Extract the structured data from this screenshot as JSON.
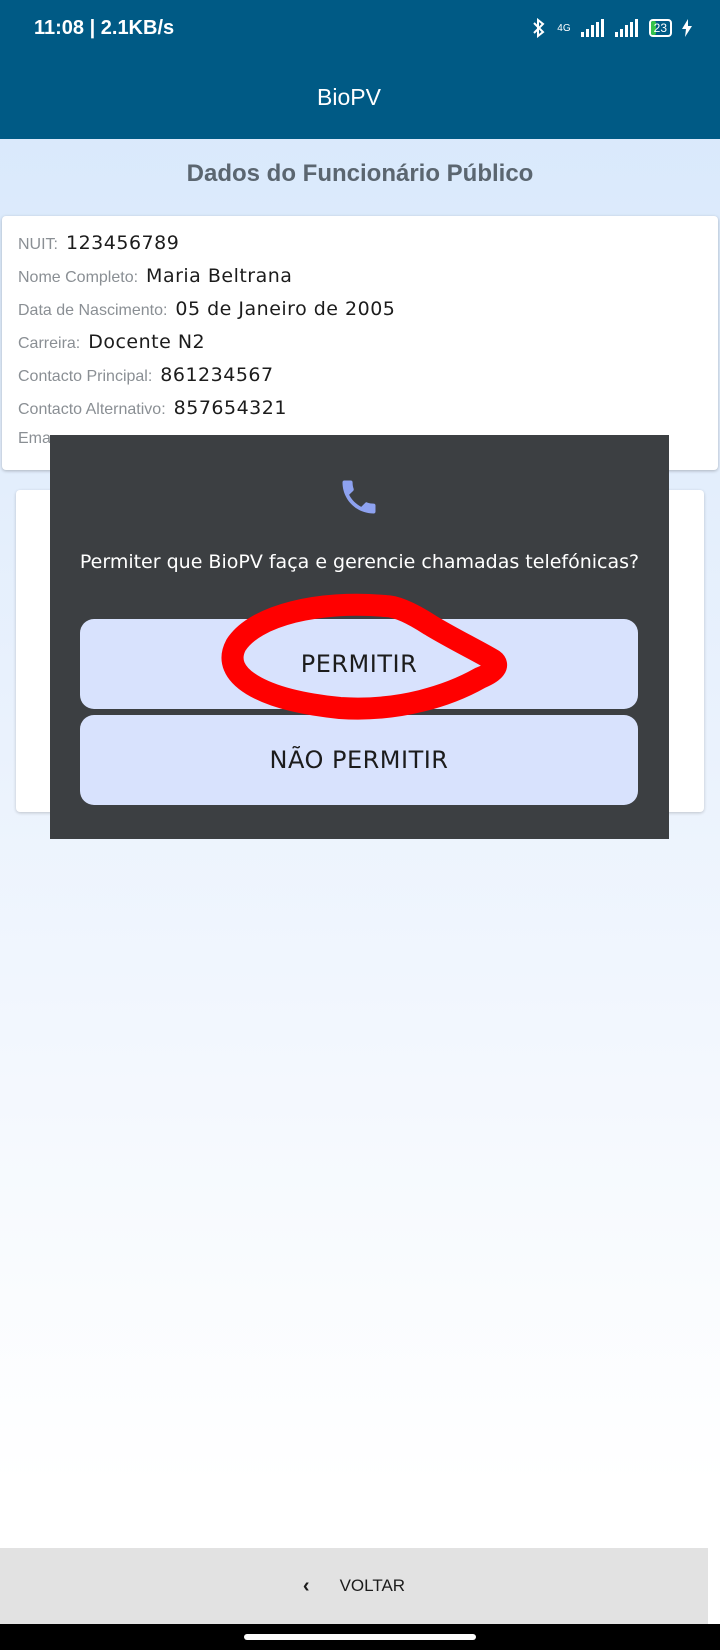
{
  "status_bar": {
    "time_speed": "11:08 | 2.1KB/s",
    "network": "4G",
    "battery": "23"
  },
  "app_bar": {
    "title": "BioPV"
  },
  "section": {
    "title": "Dados do Funcionário Público"
  },
  "fields": [
    {
      "label": "NUIT:",
      "value": "123456789"
    },
    {
      "label": "Nome Completo:",
      "value": "Maria Beltrana"
    },
    {
      "label": "Data de Nascimento:",
      "value": "05 de Janeiro de 2005"
    },
    {
      "label": "Carreira:",
      "value": "Docente N2"
    },
    {
      "label": "Contacto Principal:",
      "value": "861234567"
    },
    {
      "label": "Contacto Alternativo:",
      "value": "857654321"
    },
    {
      "label": "Ema",
      "value": ""
    }
  ],
  "dialog": {
    "icon": "phone-icon",
    "message": "Permiter que BioPV faça e gerencie chamadas telefónicas?",
    "allow_label": "PERMITIR",
    "deny_label": "NÃO PERMITIR"
  },
  "bottom_bar": {
    "back_label": "VOLTAR"
  },
  "colors": {
    "primary": "#005a85",
    "dialog_bg": "#3c3f42",
    "button_bg": "#d8e2fd",
    "icon_accent": "#8ea2f0",
    "annotation": "#ff0000"
  }
}
